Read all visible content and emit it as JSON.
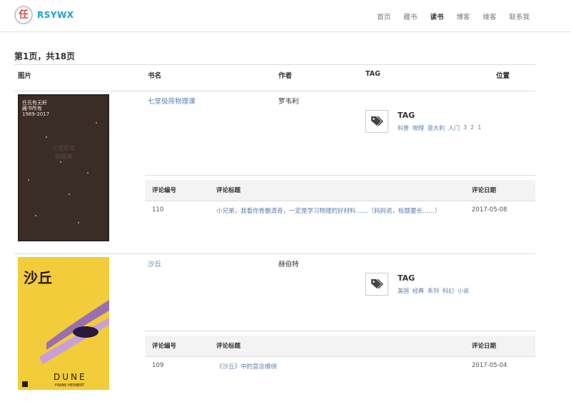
{
  "header": {
    "logo_char": "任",
    "logo_text": "RSYWX",
    "nav": [
      "首页",
      "藏书",
      "读书",
      "博客",
      "维客",
      "联系我"
    ]
  },
  "page_title": "第1页，共18页",
  "columns": [
    "图片",
    "书名",
    "作者",
    "TAG",
    "位置"
  ],
  "comment_columns": [
    "评论编号",
    "评论标题",
    "评论日期"
  ],
  "books": [
    {
      "title": "七堂极简物理课",
      "author": "罗韦利",
      "cover_text": [
        "任氏有无轩",
        "藏书所有",
        "1989-2017",
        "七堂极简",
        "物理课"
      ],
      "tag_label": "TAG",
      "tags": [
        "科普",
        "物理",
        "意大利",
        "入门",
        "3",
        "2",
        "1"
      ],
      "comment": {
        "id": "110",
        "title": "小兄弟，我看你骨骼清奇，一定是学习物理的好材料……（妈妈说，标题要长……）",
        "date": "2017-05-08"
      }
    },
    {
      "title": "沙丘",
      "author": "赫伯特",
      "cover_text": [
        "沙丘",
        "DUNE",
        "FRANK HERBERT"
      ],
      "tag_label": "TAG",
      "tags": [
        "美国",
        "经典",
        "系列",
        "科幻",
        "小说"
      ],
      "comment": {
        "id": "109",
        "title": "《沙丘》中的意念缠绕",
        "date": "2017-05-04"
      }
    }
  ]
}
